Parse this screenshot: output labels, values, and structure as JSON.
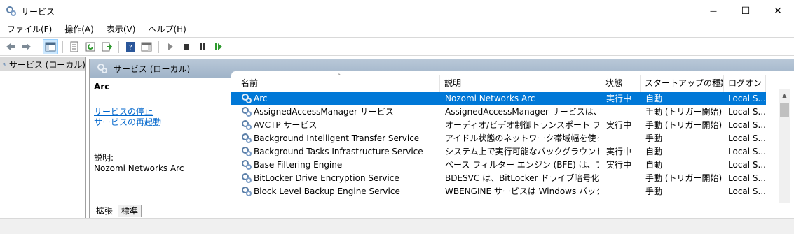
{
  "window": {
    "title": "サービス",
    "minimize_glyph": "—",
    "maximize_glyph": "☐",
    "close_glyph": "✕"
  },
  "menu": {
    "items": [
      {
        "label": "ファイル(F)"
      },
      {
        "label": "操作(A)"
      },
      {
        "label": "表示(V)"
      },
      {
        "label": "ヘルプ(H)"
      }
    ]
  },
  "toolbar": {
    "icons": [
      "back-icon",
      "forward-icon",
      "show-hide-console-tree-icon",
      "properties-icon",
      "refresh-icon",
      "export-list-icon",
      "help-icon",
      "show-hide-action-pane-icon",
      "start-service-icon",
      "stop-service-icon",
      "pause-service-icon",
      "restart-service-icon"
    ]
  },
  "tree": {
    "selected_label": "サービス (ローカル)"
  },
  "header_band": {
    "title": "サービス (ローカル)"
  },
  "details": {
    "service_name": "Arc",
    "stop_link": "サービスの停止",
    "restart_link": "サービスの再起動",
    "description_label": "説明:",
    "description_value": "Nozomi Networks Arc"
  },
  "table": {
    "columns": {
      "name": "名前",
      "description": "説明",
      "status": "状態",
      "startup_type": "スタートアップの種類",
      "logon": "ログオン"
    },
    "sort_indicator": "^",
    "rows": [
      {
        "name": "Arc",
        "description": "Nozomi Networks Arc",
        "status": "実行中",
        "startup": "自動",
        "logon": "Local S...",
        "selected": true
      },
      {
        "name": "AssignedAccessManager サービス",
        "description": "AssignedAccessManager サービスは、Win...",
        "status": "",
        "startup": "手動 (トリガー開始)",
        "logon": "Local S..."
      },
      {
        "name": "AVCTP サービス",
        "description": "オーディオ/ビデオ制御トランスポート プロトコル ...",
        "status": "実行中",
        "startup": "手動 (トリガー開始)",
        "logon": "Local S..."
      },
      {
        "name": "Background Intelligent Transfer Service",
        "description": "アイドル状態のネットワーク帯域幅を使ってバ...",
        "status": "",
        "startup": "手動",
        "logon": "Local S..."
      },
      {
        "name": "Background Tasks Infrastructure Service",
        "description": "システム上で実行可能なバックグラウンド タス...",
        "status": "実行中",
        "startup": "自動",
        "logon": "Local S..."
      },
      {
        "name": "Base Filtering Engine",
        "description": "ベース フィルター エンジン (BFE) は、ファイアウ...",
        "status": "実行中",
        "startup": "自動",
        "logon": "Local S..."
      },
      {
        "name": "BitLocker Drive Encryption Service",
        "description": "BDESVC は、BitLocker ドライブ暗号化サー...",
        "status": "",
        "startup": "手動 (トリガー開始)",
        "logon": "Local S..."
      },
      {
        "name": "Block Level Backup Engine Service",
        "description": "WBENGINE サービスは Windows バックアッ...",
        "status": "",
        "startup": "手動",
        "logon": "Local S..."
      }
    ]
  },
  "tabs": {
    "extended": "拡張",
    "standard": "標準"
  },
  "colors": {
    "selection": "#0078d7",
    "link": "#0066cc",
    "header_band": "#a9bbcf"
  }
}
